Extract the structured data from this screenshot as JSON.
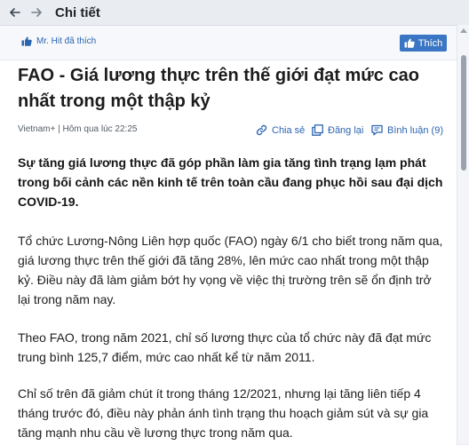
{
  "window": {
    "title": "Chi tiết"
  },
  "likebar": {
    "liked_by": "Mr. Hit đã thích",
    "like_button": "Thích"
  },
  "article": {
    "title": "FAO - Giá lương thực trên thế giới đạt mức cao nhất trong một thập kỷ",
    "meta": "Vietnam+ | Hôm qua lúc 22:25",
    "actions": {
      "share": "Chia sẻ",
      "repost": "Đăng lại",
      "comment": "Bình luận (9)"
    },
    "lead": "Sự tăng giá lương thực đã góp phần làm gia tăng tình trạng lạm phát trong bối cảnh các nền kinh tế trên toàn cầu đang phục hồi sau đại dịch COVID-19.",
    "paragraphs": [
      "Tổ chức Lương-Nông Liên hợp quốc (FAO) ngày 6/1 cho biết trong năm qua, giá lương thực trên thế giới đã tăng 28%, lên mức cao nhất trong một thập kỷ. Điều này đã làm giảm bớt hy vọng về việc thị trường trên sẽ ổn định trở lại trong năm nay.",
      "Theo FAO, trong năm 2021, chỉ số lương thực của tổ chức này đã đạt mức trung bình 125,7 điểm, mức cao nhất kể từ năm 2011.",
      "Chỉ số trên đã giảm chút ít trong tháng 12/2021, nhưng lại tăng liên tiếp 4 tháng trước đó, điều này phản ánh tình trạng thu hoạch giảm sút và sự gia tăng mạnh nhu cầu về lương thực trong năm qua."
    ]
  },
  "icons": {
    "back": "arrow-left-icon",
    "forward": "arrow-right-icon",
    "like": "thumbs-up-icon",
    "share": "link-icon",
    "repost": "copy-icon",
    "comment": "speech-bubble-icon"
  }
}
